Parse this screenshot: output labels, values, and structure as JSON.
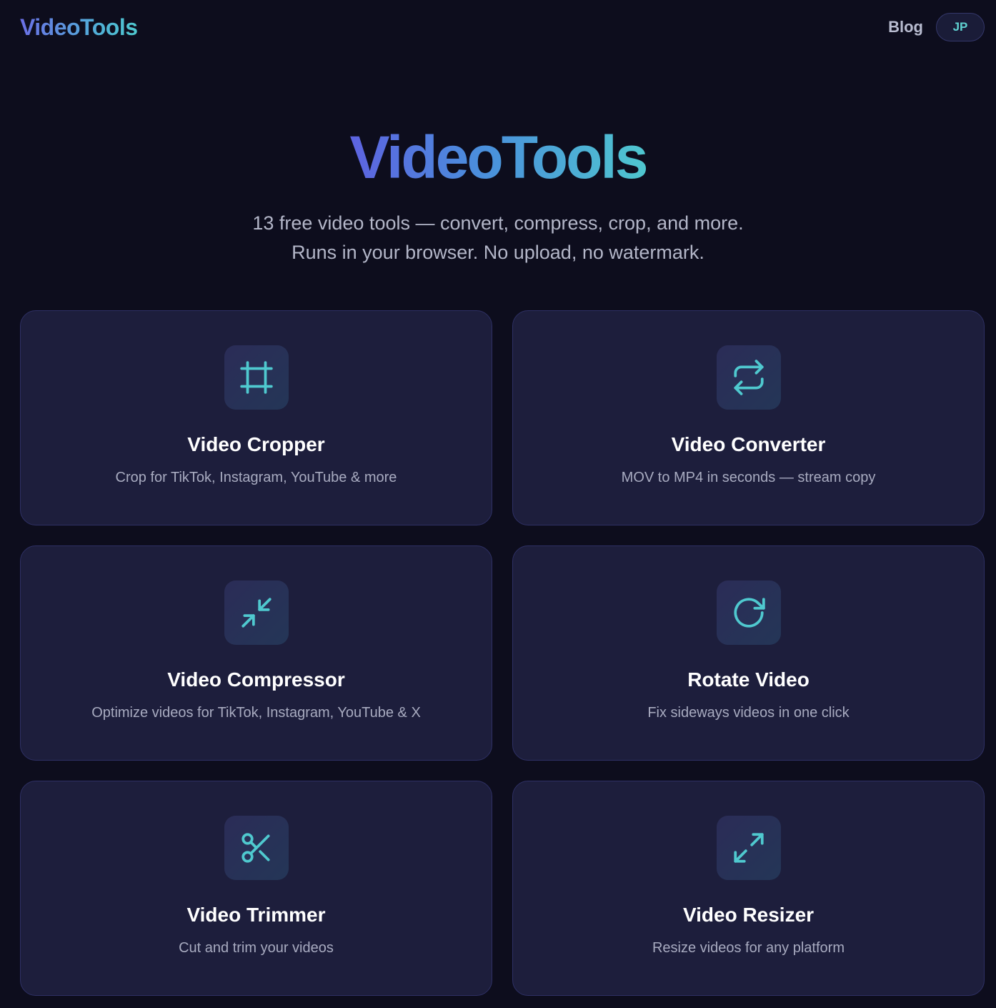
{
  "header": {
    "logo": "VideoTools",
    "nav": {
      "blog_label": "Blog",
      "lang_label": "JP"
    }
  },
  "hero": {
    "title": "VideoTools",
    "subtitle_line1": "13 free video tools — convert, compress, crop, and more.",
    "subtitle_line2": "Runs in your browser. No upload, no watermark."
  },
  "colors": {
    "background": "#0d0d1d",
    "card": "#1d1e3c",
    "accent_teal": "#4fc9cf",
    "accent_indigo": "#5d63e0"
  },
  "tools": [
    {
      "icon": "crop-icon",
      "title": "Video Cropper",
      "description": "Crop for TikTok, Instagram, YouTube & more"
    },
    {
      "icon": "convert-arrows-icon",
      "title": "Video Converter",
      "description": "MOV to MP4 in seconds — stream copy"
    },
    {
      "icon": "compress-arrows-icon",
      "title": "Video Compressor",
      "description": "Optimize videos for TikTok, Instagram, YouTube & X"
    },
    {
      "icon": "rotate-icon",
      "title": "Rotate Video",
      "description": "Fix sideways videos in one click"
    },
    {
      "icon": "scissors-icon",
      "title": "Video Trimmer",
      "description": "Cut and trim your videos"
    },
    {
      "icon": "expand-arrows-icon",
      "title": "Video Resizer",
      "description": "Resize videos for any platform"
    }
  ]
}
